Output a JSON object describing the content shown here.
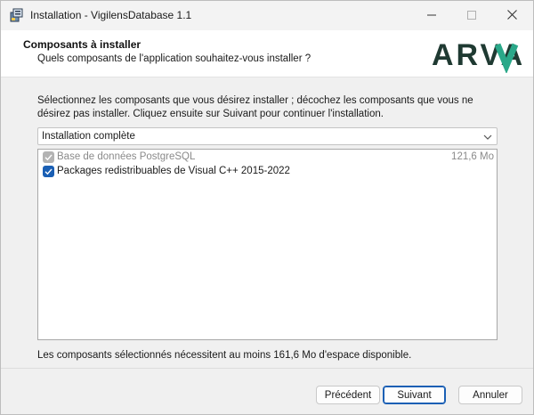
{
  "window": {
    "title": "Installation - VigilensDatabase 1.1"
  },
  "icons": {
    "app": "installer-box-icon",
    "minimize": "minimize-icon",
    "maximize": "maximize-icon",
    "close": "close-icon",
    "dropdown": "chevron-down-icon",
    "check": "checkmark-icon"
  },
  "header": {
    "title": "Composants à installer",
    "subtitle": "Quels composants de l'application souhaitez-vous installer ?",
    "logo_text": "ARVA",
    "logo_color": "#1f3a32",
    "logo_accent": "#2aa889"
  },
  "body": {
    "description": "Sélectionnez les composants que vous désirez installer ; décochez les composants que vous ne désirez pas installer. Cliquez ensuite sur Suivant pour continuer l'installation.",
    "install_type": {
      "selected": "Installation complète"
    },
    "components": [
      {
        "label": "Base de données PostgreSQL",
        "size": "121,6 Mo",
        "checked": true,
        "enabled": false
      },
      {
        "label": "Packages redistribuables de Visual C++ 2015-2022",
        "size": "",
        "checked": true,
        "enabled": true
      }
    ],
    "space_required": "Les composants sélectionnés nécessitent au moins 161,6 Mo d'espace disponible."
  },
  "footer": {
    "back_label": "Précédent",
    "next_label": "Suivant",
    "cancel_label": "Annuler"
  },
  "colors": {
    "accent": "#1a5fb4",
    "background": "#f0f0f0"
  }
}
